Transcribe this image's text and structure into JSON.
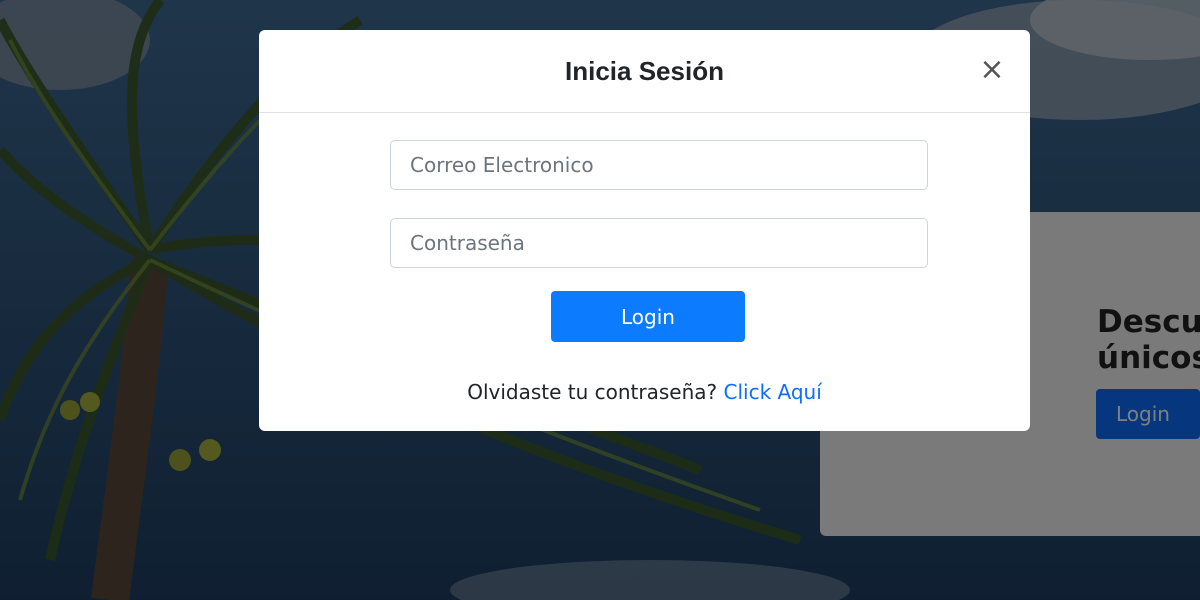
{
  "modal": {
    "title": "Inicia Sesión",
    "close_label": "×",
    "email_placeholder": "Correo Electronico",
    "password_placeholder": "Contraseña",
    "login_label": "Login",
    "forgot_text": "Olvidaste tu contraseña?",
    "forgot_link": "Click Aquí"
  },
  "background_card": {
    "title": "Descu\núnicos",
    "login_label": "Login"
  },
  "colors": {
    "primary": "#0d6efd",
    "backdrop": "rgba(0,0,0,0.5)"
  }
}
